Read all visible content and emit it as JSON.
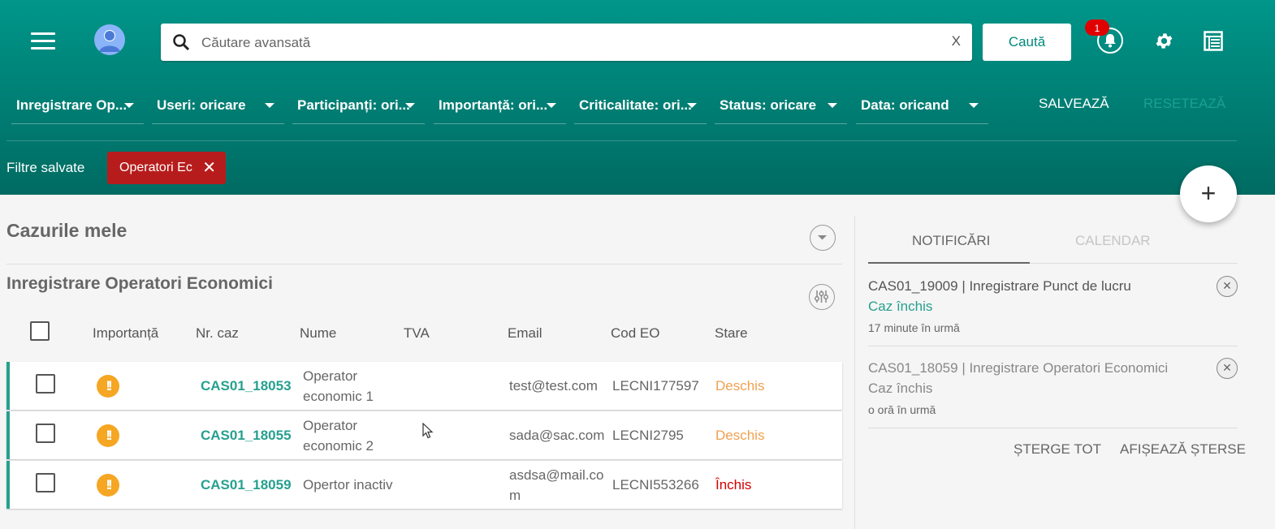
{
  "header": {
    "search_placeholder": "Căutare avansată",
    "clear_label": "X",
    "search_button": "Caută",
    "notif_count": "1"
  },
  "filters": [
    {
      "label": "Inregistrare Op..."
    },
    {
      "label": "Useri: oricare"
    },
    {
      "label": "Participanți: ori..."
    },
    {
      "label": "Importanță: ori..."
    },
    {
      "label": "Criticalitate: ori..."
    },
    {
      "label": "Status: oricare"
    },
    {
      "label": "Data: oricand"
    }
  ],
  "filter_actions": {
    "save": "SALVEAZĂ",
    "reset": "RESETEAZĂ"
  },
  "saved_filters": {
    "label": "Filtre salvate",
    "chip": "Operatori Ec"
  },
  "fab_label": "+",
  "main": {
    "section_title": "Cazurile mele",
    "table_title": "Inregistrare Operatori Economici",
    "columns": [
      "Importanță",
      "Nr. caz",
      "Nume",
      "TVA",
      "Email",
      "Cod EO",
      "Stare"
    ],
    "rows": [
      {
        "importance": "!!",
        "case": "CAS01_18053",
        "name1": "Operator",
        "name2": "economic 1",
        "tva": "",
        "email1": "test@test.com",
        "email2": "",
        "cod": "LECNI177597",
        "status": "Deschis"
      },
      {
        "importance": "!!",
        "case": "CAS01_18055",
        "name1": "Operator",
        "name2": "economic 2",
        "tva": "",
        "email1": "sada@sac.com",
        "email2": "",
        "cod": "LECNI2795",
        "status": "Deschis"
      },
      {
        "importance": "!!",
        "case": "CAS01_18059",
        "name1": "Opertor inactiv",
        "name2": "",
        "tva": "",
        "email1": "asdsa@mail.co",
        "email2": "m",
        "cod": "LECNI553266",
        "status": "Închis"
      }
    ]
  },
  "side": {
    "tabs": [
      "NOTIFICĂRI",
      "CALENDAR"
    ],
    "notifications": [
      {
        "title": "CAS01_19009 | Inregistrare Punct de lucru",
        "status": "Caz închis",
        "time": "17 minute în urmă"
      },
      {
        "title": "CAS01_18059 | Inregistrare Operatori Economici",
        "status": "Caz închis",
        "time": "o oră în urmă"
      }
    ],
    "delete_all": "ȘTERGE TOT",
    "show_deleted": "AFIȘEAZĂ ȘTERSE"
  },
  "colors": {
    "primary": "#00897b",
    "accent_text": "#26a08f",
    "chip": "#b71c1c",
    "importance": "#f5a623",
    "open": "#f0a050",
    "closed": "#d40000"
  }
}
